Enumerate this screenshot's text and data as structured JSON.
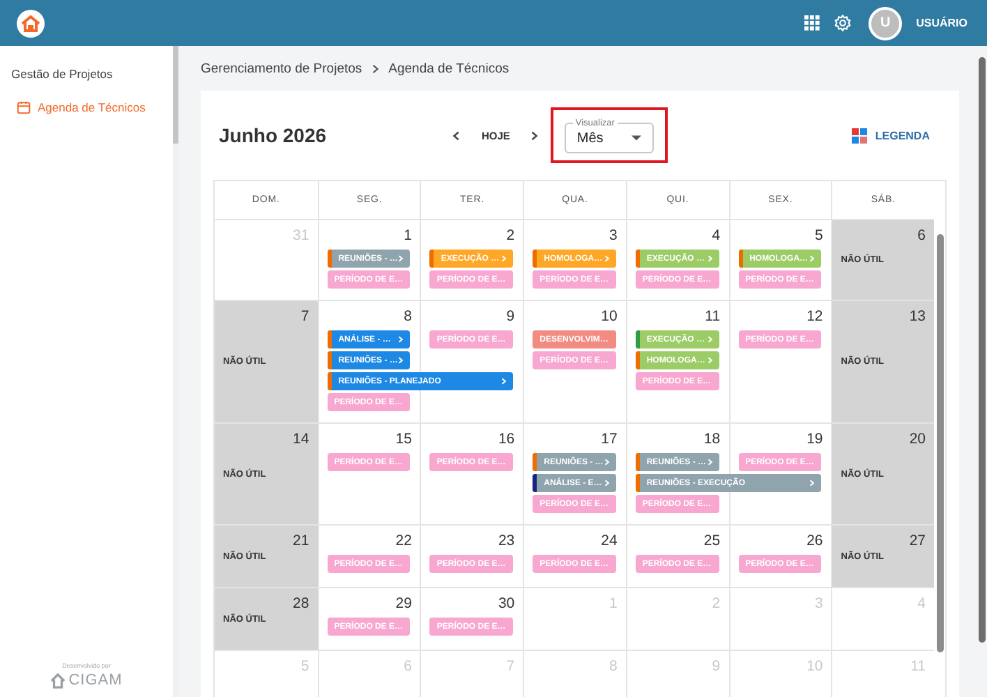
{
  "top_bar": {
    "user_initial": "U",
    "user_name": "USUÁRIO"
  },
  "sidebar": {
    "section": "Gestão de Projetos",
    "items": [
      {
        "label": "Agenda de Técnicos",
        "selected": true
      }
    ],
    "footer": {
      "caption": "Desenvolvido por",
      "brand": "CIGAM"
    }
  },
  "breadcrumb": [
    "Gerenciamento de Projetos",
    "Agenda de Técnicos"
  ],
  "calendar": {
    "title": "Junho 2026",
    "today_button": "HOJE",
    "view_select": {
      "label": "Visualizar",
      "value": "Mês",
      "highlighted": true
    },
    "legend_button": "LEGENDA",
    "weekdays": [
      "DOM.",
      "SEG.",
      "TER.",
      "QUA.",
      "QUI.",
      "SEX.",
      "SÁB."
    ],
    "weeks": [
      {
        "days": [
          {
            "number": "31",
            "in_month": false,
            "non_working": false
          },
          {
            "number": "1",
            "in_month": true,
            "non_working": false,
            "events": [
              {
                "label": "REUNIÕES - …",
                "kind": "single",
                "color": "#90a4ae",
                "stripe": {
                  "color": "#ef6c00"
                },
                "expandable": true
              },
              {
                "label": "PERÍODO DE E…",
                "kind": "single",
                "color": "#f8a8d0",
                "expandable": false
              }
            ]
          },
          {
            "number": "2",
            "in_month": true,
            "non_working": false,
            "events": [
              {
                "label": "EXECUÇÃO …",
                "kind": "single",
                "color": "#ffa726",
                "stripe": {
                  "color": "#ef6c00"
                },
                "expandable": true
              },
              {
                "label": "PERÍODO DE E…",
                "kind": "single",
                "color": "#f8a8d0",
                "expandable": false
              }
            ]
          },
          {
            "number": "3",
            "in_month": true,
            "non_working": false,
            "events": [
              {
                "label": "HOMOLOGA…",
                "kind": "single",
                "color": "#ffa726",
                "stripe": {
                  "color": "#ef6c00"
                },
                "expandable": true
              },
              {
                "label": "PERÍODO DE E…",
                "kind": "single",
                "color": "#f8a8d0",
                "expandable": false
              }
            ]
          },
          {
            "number": "4",
            "in_month": true,
            "non_working": false,
            "events": [
              {
                "label": "EXECUÇÃO …",
                "kind": "single",
                "color": "#9ccc65",
                "stripe": {
                  "color": "#ef6c00"
                },
                "expandable": true
              },
              {
                "label": "PERÍODO DE E…",
                "kind": "single",
                "color": "#f8a8d0",
                "expandable": false
              }
            ]
          },
          {
            "number": "5",
            "in_month": true,
            "non_working": false,
            "events": [
              {
                "label": "HOMOLOGA…",
                "kind": "single",
                "color": "#9ccc65",
                "stripe": {
                  "color": "#ef6c00"
                },
                "expandable": true
              },
              {
                "label": "PERÍODO DE E…",
                "kind": "single",
                "color": "#f8a8d0",
                "expandable": false
              }
            ]
          },
          {
            "number": "6",
            "in_month": true,
            "non_working": true,
            "non_working_label": "NÃO ÚTIL"
          }
        ]
      },
      {
        "days": [
          {
            "number": "7",
            "in_month": true,
            "non_working": true,
            "non_working_label": "NÃO ÚTIL"
          },
          {
            "number": "8",
            "in_month": true,
            "non_working": false,
            "events": [
              {
                "label": "ANÁLISE - …",
                "kind": "single",
                "color": "#1e88e5",
                "stripe": {
                  "color": "#ef6c00"
                },
                "expandable": true
              },
              {
                "label": "REUNIÕES - …",
                "kind": "single",
                "color": "#1e88e5",
                "stripe": {
                  "color": "#ef6c00"
                },
                "expandable": true
              },
              {
                "label": "REUNIÕES - PLANEJADO",
                "kind": "wide",
                "color": "#1e88e5",
                "stripe": {
                  "color": "#ef6c00"
                },
                "expandable": true
              },
              {
                "label": "PERÍODO DE E…",
                "kind": "single",
                "color": "#f8a8d0",
                "expandable": false
              }
            ]
          },
          {
            "number": "9",
            "in_month": true,
            "non_working": false,
            "events": [
              {
                "label": "PERÍODO DE E…",
                "kind": "single",
                "color": "#f8a8d0",
                "expandable": false
              }
            ]
          },
          {
            "number": "10",
            "in_month": true,
            "non_working": false,
            "events": [
              {
                "label": "DESENVOLVIM…",
                "kind": "single",
                "color": "#f28b82",
                "expandable": false
              },
              {
                "label": "PERÍODO DE E…",
                "kind": "single",
                "color": "#f8a8d0",
                "expandable": false
              }
            ]
          },
          {
            "number": "11",
            "in_month": true,
            "non_working": false,
            "events": [
              {
                "label": "EXECUÇÃO …",
                "kind": "single",
                "color": "#9ccc65",
                "stripe": {
                  "color": "#2e9e44"
                },
                "expandable": true
              },
              {
                "label": "HOMOLOGA…",
                "kind": "single",
                "color": "#9ccc65",
                "stripe": {
                  "color": "#ef6c00"
                },
                "expandable": true
              },
              {
                "label": "PERÍODO DE E…",
                "kind": "single",
                "color": "#f8a8d0",
                "expandable": false
              }
            ]
          },
          {
            "number": "12",
            "in_month": true,
            "non_working": false,
            "events": [
              {
                "label": "PERÍODO DE E…",
                "kind": "single",
                "color": "#f8a8d0",
                "expandable": false
              }
            ]
          },
          {
            "number": "13",
            "in_month": true,
            "non_working": true,
            "non_working_label": "NÃO ÚTIL"
          }
        ]
      },
      {
        "days": [
          {
            "number": "14",
            "in_month": true,
            "non_working": true,
            "non_working_label": "NÃO ÚTIL"
          },
          {
            "number": "15",
            "in_month": true,
            "non_working": false,
            "events": [
              {
                "label": "PERÍODO DE E…",
                "kind": "single",
                "color": "#f8a8d0",
                "expandable": false
              }
            ]
          },
          {
            "number": "16",
            "in_month": true,
            "non_working": false,
            "events": [
              {
                "label": "PERÍODO DE E…",
                "kind": "single",
                "color": "#f8a8d0",
                "expandable": false
              }
            ]
          },
          {
            "number": "17",
            "in_month": true,
            "non_working": false,
            "events": [
              {
                "label": "REUNIÕES - …",
                "kind": "single",
                "color": "#90a4ae",
                "stripe": {
                  "color": "#ef6c00"
                },
                "expandable": true
              },
              {
                "label": "ANÁLISE - E…",
                "kind": "single",
                "color": "#90a4ae",
                "stripe": {
                  "color": "#1a237e"
                },
                "expandable": true
              },
              {
                "label": "PERÍODO DE E…",
                "kind": "single",
                "color": "#f8a8d0",
                "expandable": false
              }
            ]
          },
          {
            "number": "18",
            "in_month": true,
            "non_working": false,
            "events": [
              {
                "label": "REUNIÕES - …",
                "kind": "single",
                "color": "#90a4ae",
                "stripe": {
                  "color": "#ef6c00"
                },
                "expandable": true
              },
              {
                "label": "REUNIÕES - EXECUÇÃO",
                "kind": "wide",
                "color": "#90a4ae",
                "stripe": {
                  "color": "#ef6c00"
                },
                "expandable": true
              },
              {
                "label": "PERÍODO DE E…",
                "kind": "single",
                "color": "#f8a8d0",
                "expandable": false
              }
            ]
          },
          {
            "number": "19",
            "in_month": true,
            "non_working": false,
            "events": [
              {
                "label": "PERÍODO DE E…",
                "kind": "single",
                "color": "#f8a8d0",
                "expandable": false
              }
            ]
          },
          {
            "number": "20",
            "in_month": true,
            "non_working": true,
            "non_working_label": "NÃO ÚTIL"
          }
        ]
      },
      {
        "days": [
          {
            "number": "21",
            "in_month": true,
            "non_working": true,
            "non_working_label": "NÃO ÚTIL"
          },
          {
            "number": "22",
            "in_month": true,
            "non_working": false,
            "events": [
              {
                "label": "PERÍODO DE E…",
                "kind": "single",
                "color": "#f8a8d0",
                "expandable": false
              }
            ]
          },
          {
            "number": "23",
            "in_month": true,
            "non_working": false,
            "events": [
              {
                "label": "PERÍODO DE E…",
                "kind": "single",
                "color": "#f8a8d0",
                "expandable": false
              }
            ]
          },
          {
            "number": "24",
            "in_month": true,
            "non_working": false,
            "events": [
              {
                "label": "PERÍODO DE E…",
                "kind": "single",
                "color": "#f8a8d0",
                "expandable": false
              }
            ]
          },
          {
            "number": "25",
            "in_month": true,
            "non_working": false,
            "events": [
              {
                "label": "PERÍODO DE E…",
                "kind": "single",
                "color": "#f8a8d0",
                "expandable": false
              }
            ]
          },
          {
            "number": "26",
            "in_month": true,
            "non_working": false,
            "events": [
              {
                "label": "PERÍODO DE E…",
                "kind": "single",
                "color": "#f8a8d0",
                "expandable": false
              }
            ]
          },
          {
            "number": "27",
            "in_month": true,
            "non_working": true,
            "non_working_label": "NÃO ÚTIL"
          }
        ]
      },
      {
        "days": [
          {
            "number": "28",
            "in_month": true,
            "non_working": true,
            "non_working_label": "NÃO ÚTIL"
          },
          {
            "number": "29",
            "in_month": true,
            "non_working": false,
            "events": [
              {
                "label": "PERÍODO DE E…",
                "kind": "single",
                "color": "#f8a8d0",
                "expandable": false
              }
            ]
          },
          {
            "number": "30",
            "in_month": true,
            "non_working": false,
            "events": [
              {
                "label": "PERÍODO DE E…",
                "kind": "single",
                "color": "#f8a8d0",
                "expandable": false
              }
            ]
          },
          {
            "number": "1",
            "in_month": false,
            "non_working": false
          },
          {
            "number": "2",
            "in_month": false,
            "non_working": false
          },
          {
            "number": "3",
            "in_month": false,
            "non_working": false
          },
          {
            "number": "4",
            "in_month": false,
            "non_working": false
          }
        ]
      },
      {
        "days": [
          {
            "number": "5",
            "in_month": false,
            "non_working": false
          },
          {
            "number": "6",
            "in_month": false,
            "non_working": false
          },
          {
            "number": "7",
            "in_month": false,
            "non_working": false
          },
          {
            "number": "8",
            "in_month": false,
            "non_working": false
          },
          {
            "number": "9",
            "in_month": false,
            "non_working": false
          },
          {
            "number": "10",
            "in_month": false,
            "non_working": false
          },
          {
            "number": "11",
            "in_month": false,
            "non_working": false
          }
        ]
      }
    ]
  }
}
